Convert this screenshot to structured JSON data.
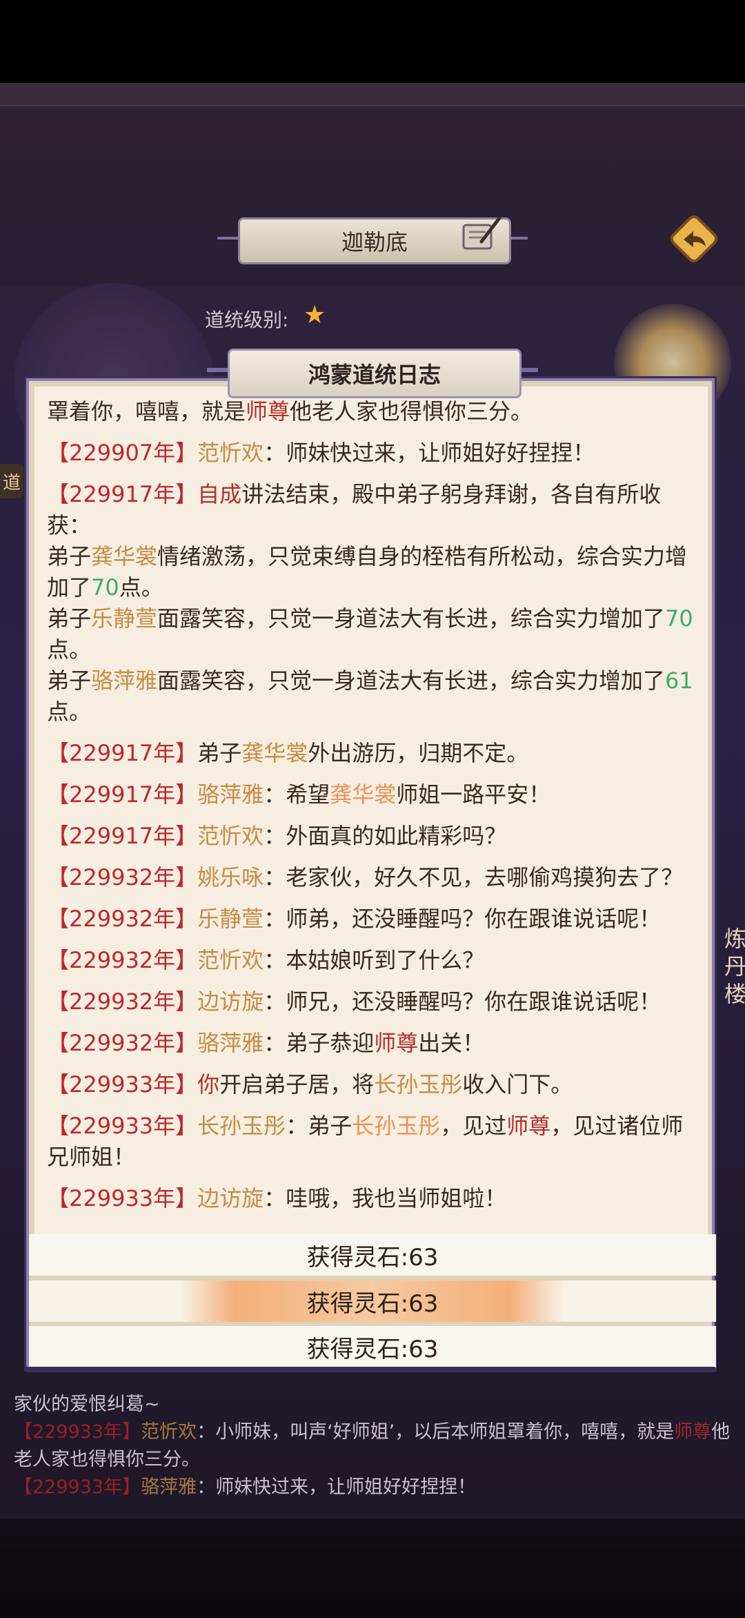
{
  "header": {
    "title": "迦勒底",
    "rank_label": "道统级别:",
    "rank_star": "★",
    "side_tag": "道",
    "side_right": "炼丹楼"
  },
  "modal": {
    "title": "鸿蒙道统日志"
  },
  "log": [
    [
      {
        "t": "罩着你，嘻嘻，就是",
        "c": ""
      },
      {
        "t": "师尊",
        "c": "s"
      },
      {
        "t": "他老人家也得惧你三分。",
        "c": ""
      }
    ],
    [
      {
        "t": "【229907年】",
        "c": "y"
      },
      {
        "t": "范忻欢",
        "c": "n"
      },
      {
        "t": "：师妹快过来，让师姐好好捏捏！",
        "c": ""
      }
    ],
    [
      {
        "t": "【229917年】",
        "c": "y"
      },
      {
        "t": "自成",
        "c": "s"
      },
      {
        "t": "讲法结束，殿中弟子躬身拜谢，各自有所收获：",
        "c": ""
      },
      {
        "br": true
      },
      {
        "t": "弟子",
        "c": ""
      },
      {
        "t": "龚华裳",
        "c": "n"
      },
      {
        "t": "情绪激荡，只觉束缚自身的桎梏有所松动，综合实力增加了",
        "c": ""
      },
      {
        "t": "70",
        "c": "g"
      },
      {
        "t": "点。",
        "c": ""
      },
      {
        "br": true
      },
      {
        "t": "弟子",
        "c": ""
      },
      {
        "t": "乐静萱",
        "c": "n"
      },
      {
        "t": "面露笑容，只觉一身道法大有长进，综合实力增加了",
        "c": ""
      },
      {
        "t": "70",
        "c": "g"
      },
      {
        "t": "点。",
        "c": ""
      },
      {
        "br": true
      },
      {
        "t": "弟子",
        "c": ""
      },
      {
        "t": "骆萍雅",
        "c": "n"
      },
      {
        "t": "面露笑容，只觉一身道法大有长进，综合实力增加了",
        "c": ""
      },
      {
        "t": "61",
        "c": "g"
      },
      {
        "t": "点。",
        "c": ""
      }
    ],
    [
      {
        "t": "【229917年】",
        "c": "y"
      },
      {
        "t": "弟子",
        "c": ""
      },
      {
        "t": "龚华裳",
        "c": "n"
      },
      {
        "t": "外出游历，归期不定。",
        "c": ""
      }
    ],
    [
      {
        "t": "【229917年】",
        "c": "y"
      },
      {
        "t": "骆萍雅",
        "c": "n"
      },
      {
        "t": "：希望",
        "c": ""
      },
      {
        "t": "龚华裳",
        "c": "h"
      },
      {
        "t": "师姐一路平安！",
        "c": ""
      }
    ],
    [
      {
        "t": "【229917年】",
        "c": "y"
      },
      {
        "t": "范忻欢",
        "c": "n"
      },
      {
        "t": "：外面真的如此精彩吗？",
        "c": ""
      }
    ],
    [
      {
        "t": "【229932年】",
        "c": "y"
      },
      {
        "t": "姚乐咏",
        "c": "n"
      },
      {
        "t": "：老家伙，好久不见，去哪偷鸡摸狗去了？",
        "c": ""
      }
    ],
    [
      {
        "t": "【229932年】",
        "c": "y"
      },
      {
        "t": "乐静萱",
        "c": "n"
      },
      {
        "t": "：师弟，还没睡醒吗？你在跟谁说话呢！",
        "c": ""
      }
    ],
    [
      {
        "t": "【229932年】",
        "c": "y"
      },
      {
        "t": "范忻欢",
        "c": "n"
      },
      {
        "t": "：本姑娘听到了什么？",
        "c": ""
      }
    ],
    [
      {
        "t": "【229932年】",
        "c": "y"
      },
      {
        "t": "边访旋",
        "c": "n"
      },
      {
        "t": "：师兄，还没睡醒吗？你在跟谁说话呢！",
        "c": ""
      }
    ],
    [
      {
        "t": "【229932年】",
        "c": "y"
      },
      {
        "t": "骆萍雅",
        "c": "n"
      },
      {
        "t": "：弟子恭迎",
        "c": ""
      },
      {
        "t": "师尊",
        "c": "s"
      },
      {
        "t": "出关！",
        "c": ""
      }
    ],
    [
      {
        "t": "【229933年】",
        "c": "y"
      },
      {
        "t": "你",
        "c": "s"
      },
      {
        "t": "开启弟子居，将",
        "c": ""
      },
      {
        "t": "长孙玉彤",
        "c": "n"
      },
      {
        "t": "收入门下。",
        "c": ""
      }
    ],
    [
      {
        "t": "【229933年】",
        "c": "y"
      },
      {
        "t": "长孙玉彤",
        "c": "n"
      },
      {
        "t": "：弟子",
        "c": ""
      },
      {
        "t": "长孙玉彤",
        "c": "h"
      },
      {
        "t": "，见过",
        "c": ""
      },
      {
        "t": "师尊",
        "c": "s"
      },
      {
        "t": "，见过诸位师兄师姐！",
        "c": ""
      }
    ],
    [
      {
        "t": "【229933年】",
        "c": "y"
      },
      {
        "t": "边访旋",
        "c": "n"
      },
      {
        "t": "：哇哦，我也当师姐啦！",
        "c": ""
      }
    ]
  ],
  "toasts": [
    "获得灵石:63",
    "获得灵石:63",
    "获得灵石:63"
  ],
  "chat": [
    [
      {
        "t": "家伙的爱恨纠葛~",
        "c": ""
      }
    ],
    [
      {
        "t": "【229933年】",
        "c": "y"
      },
      {
        "t": "范忻欢",
        "c": "n"
      },
      {
        "t": "：小师妹，叫声‘好师姐’，以后本师姐罩着你，嘻嘻，就是",
        "c": ""
      },
      {
        "t": "师尊",
        "c": "s"
      },
      {
        "t": "他老人家也得惧你三分。",
        "c": ""
      }
    ],
    [
      {
        "t": "【229933年】",
        "c": "y"
      },
      {
        "t": "骆萍雅",
        "c": "n"
      },
      {
        "t": "：师妹快过来，让师姐好好捏捏！",
        "c": ""
      }
    ]
  ],
  "colors": {
    "year": "#c1262c",
    "name": "#c58b45",
    "master": "#b82d2d",
    "highlight": "#ee8f55",
    "number": "#3dab6f"
  },
  "icons": [
    "back-arrow-icon",
    "scroll-quill-icon",
    "star-icon"
  ]
}
